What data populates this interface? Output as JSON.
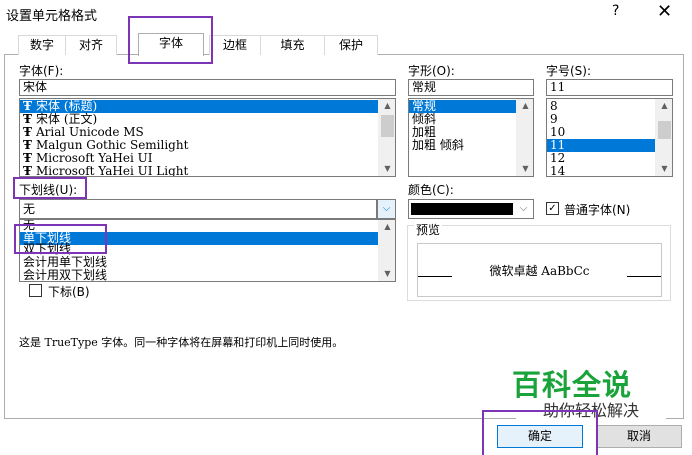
{
  "window": {
    "title": "设置单元格格式",
    "help_icon": "?",
    "close_icon": "✕"
  },
  "tabs": [
    {
      "label": "数字"
    },
    {
      "label": "对齐"
    },
    {
      "label": "字体",
      "active": true
    },
    {
      "label": "边框"
    },
    {
      "label": "填充"
    },
    {
      "label": "保护"
    }
  ],
  "font": {
    "label": "字体(F):",
    "value": "宋体",
    "items": [
      {
        "label": "宋体 (标题)",
        "selected": true
      },
      {
        "label": "宋体 (正文)"
      },
      {
        "label": "Arial Unicode MS"
      },
      {
        "label": "Malgun Gothic Semilight"
      },
      {
        "label": "Microsoft YaHei UI"
      },
      {
        "label": "Microsoft YaHei UI Light"
      }
    ],
    "item_icon": "Ŧ"
  },
  "style": {
    "label": "字形(O):",
    "value": "常规",
    "items": [
      {
        "label": "常规",
        "selected": true
      },
      {
        "label": "倾斜"
      },
      {
        "label": "加粗"
      },
      {
        "label": "加粗 倾斜"
      }
    ]
  },
  "size": {
    "label": "字号(S):",
    "value": "11",
    "items": [
      {
        "label": "8"
      },
      {
        "label": "9"
      },
      {
        "label": "10"
      },
      {
        "label": "11",
        "selected": true
      },
      {
        "label": "12"
      },
      {
        "label": "14"
      }
    ]
  },
  "underline": {
    "label": "下划线(U):",
    "value": "无",
    "dropdown_items": [
      {
        "label": "无"
      },
      {
        "label": "单下划线",
        "selected": true
      },
      {
        "label": "双下划线"
      },
      {
        "label": "会计用单下划线"
      },
      {
        "label": "会计用双下划线"
      }
    ]
  },
  "color": {
    "label": "颜色(C):",
    "swatch": "#000000"
  },
  "normal_font": {
    "label": "普通字体(N)",
    "checked": true
  },
  "effects": {
    "subscript_label": "下标(B)"
  },
  "preview": {
    "label": "预览",
    "text": "微软卓越  AaBbCc"
  },
  "description": "这是 TrueType 字体。同一种字体将在屏幕和打印机上同时使用。",
  "buttons": {
    "ok": "确定",
    "cancel": "取消"
  },
  "watermark": {
    "main": "百科全说",
    "sub": "助你轻松解决",
    "color": "#1aa33a"
  },
  "colors": {
    "selection": "#0078d7",
    "highlight_box": "#7e35b5"
  }
}
